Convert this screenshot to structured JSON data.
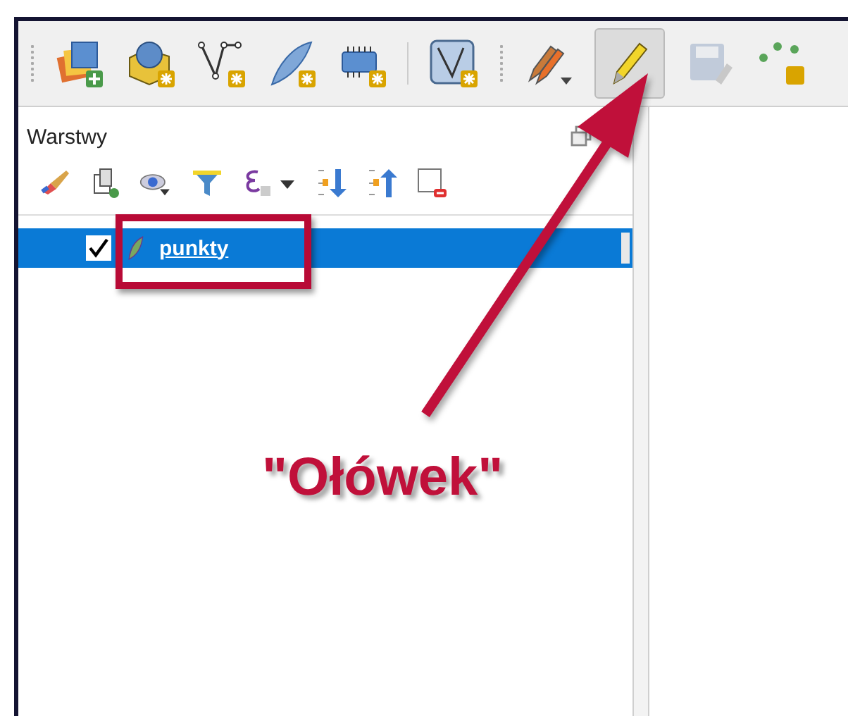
{
  "toolbar": {
    "toggle_editing_on": true,
    "save_edits_disabled": true
  },
  "layers_panel": {
    "title": "Warstwy",
    "layers": [
      {
        "name": "punkty",
        "checked": true,
        "selected": true
      }
    ]
  },
  "annotation": {
    "callout": "\"Ołówek\""
  }
}
